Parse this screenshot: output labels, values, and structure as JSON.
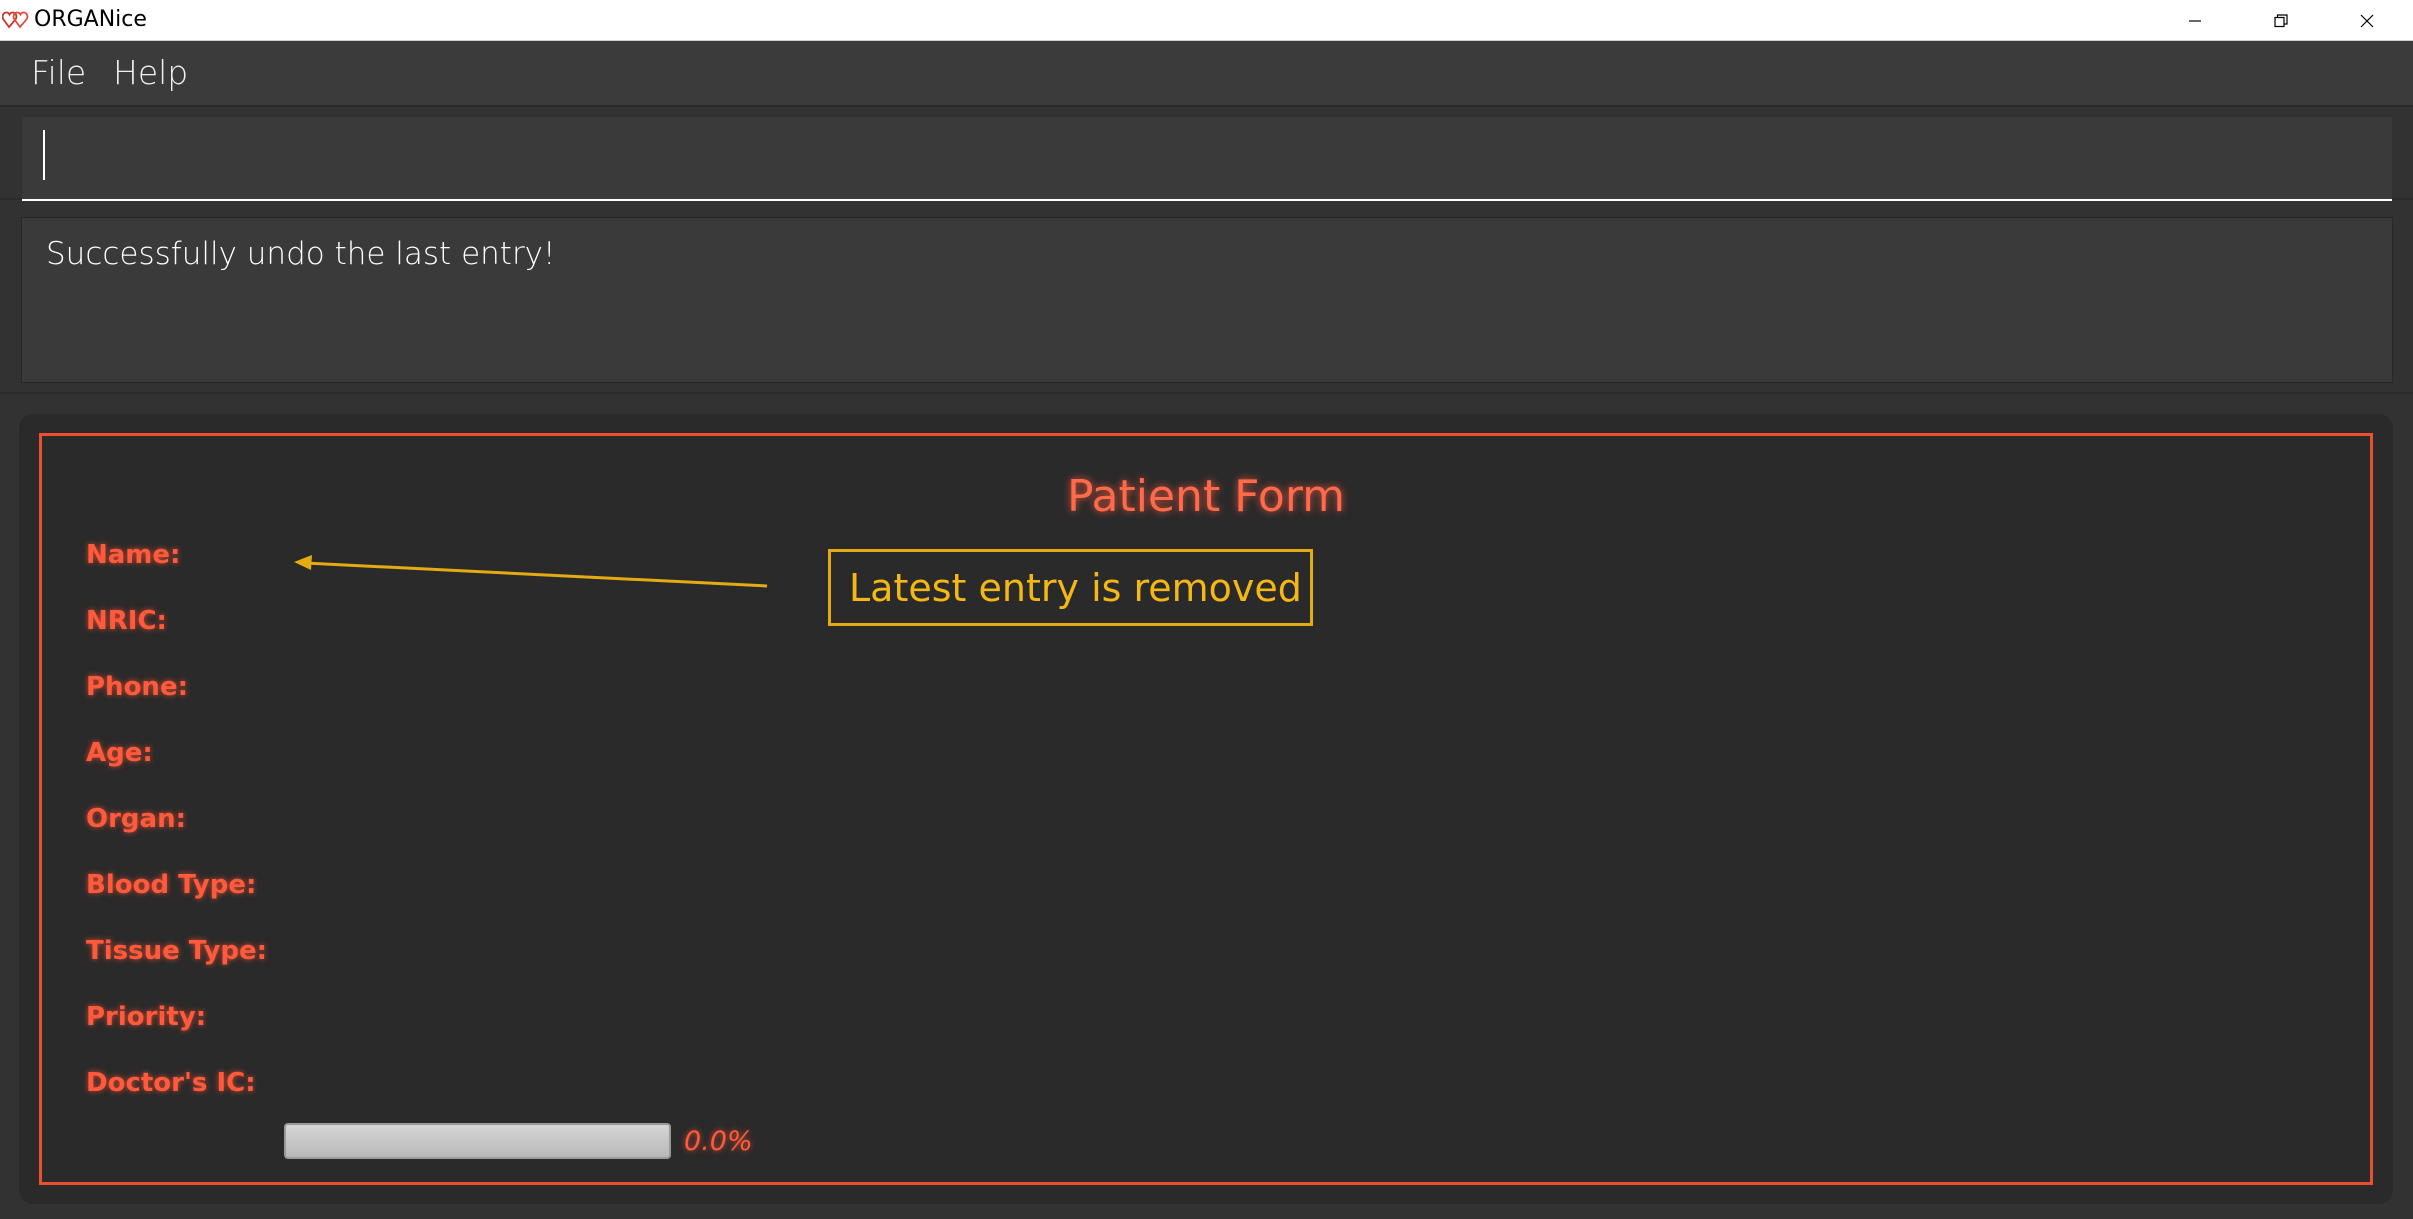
{
  "window": {
    "title": "ORGANice",
    "controls": [
      "minimize-icon",
      "restore-icon",
      "close-icon"
    ]
  },
  "menu": {
    "file": "File",
    "help": "Help"
  },
  "command": {
    "value": "",
    "placeholder": ""
  },
  "result": {
    "message": "Successfully undo the last entry!"
  },
  "form": {
    "title": "Patient Form",
    "labels": {
      "name": "Name:",
      "nric": "NRIC:",
      "phone": "Phone:",
      "age": "Age:",
      "organ": "Organ:",
      "blood_type": "Blood Type:",
      "tissue_type": "Tissue Type:",
      "priority": "Priority:",
      "doctor_ic": "Doctor's IC:"
    },
    "progress": {
      "value": 0.0,
      "text": "0.0%"
    }
  },
  "annotation": {
    "text": "Latest entry is removed"
  },
  "colors": {
    "accent": "#e8502f",
    "label": "#ff5a3c",
    "annotation": "#e4ac11",
    "background": "#323232"
  }
}
